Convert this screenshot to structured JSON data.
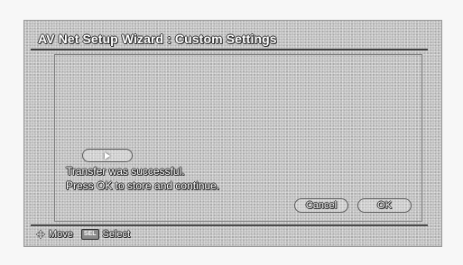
{
  "dialog": {
    "title": "AV Net Setup Wizard : Custom Settings"
  },
  "message": {
    "line1": "Transfer was successful.",
    "line2": "Press OK to store and continue."
  },
  "buttons": {
    "play_icon": "play-icon",
    "cancel_label": "Cancel",
    "ok_label": "OK"
  },
  "footer": {
    "move_icon": "dpad-arrows-icon",
    "move_label": "Move",
    "sel_badge": "SEL",
    "select_label": "Select"
  }
}
